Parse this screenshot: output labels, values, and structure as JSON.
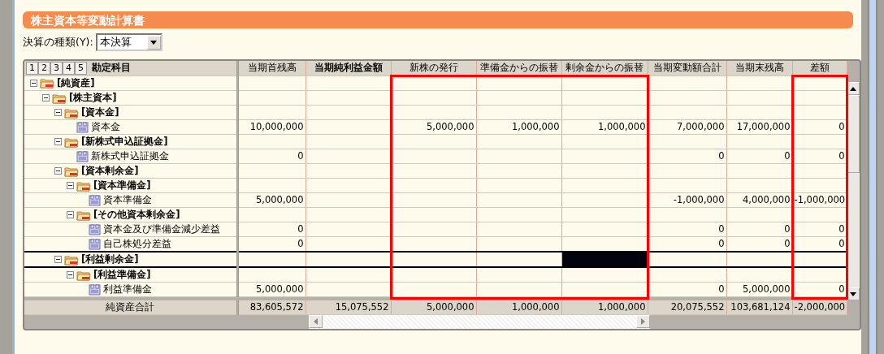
{
  "title": "株主資本等変動計算書",
  "settlement_type": {
    "label": "決算の種類(Y):",
    "value": "本決算"
  },
  "level_buttons": [
    "1",
    "2",
    "3",
    "4",
    "5"
  ],
  "tree_column": "勘定科目",
  "columns": [
    {
      "label": "当期首残高",
      "bold": false,
      "highlighted": false,
      "current": false
    },
    {
      "label": "当期純利益金額",
      "bold": true,
      "highlighted": false,
      "current": false
    },
    {
      "label": "新株の発行",
      "bold": false,
      "highlighted": true,
      "current": false
    },
    {
      "label": "準備金からの振替",
      "bold": false,
      "highlighted": true,
      "current": false
    },
    {
      "label": "剰余金からの振替",
      "bold": false,
      "highlighted": true,
      "current": true
    },
    {
      "label": "当期変動額合計",
      "bold": false,
      "highlighted": false,
      "current": false
    },
    {
      "label": "当期末残高",
      "bold": false,
      "highlighted": false,
      "current": false
    },
    {
      "label": "差額",
      "bold": false,
      "highlighted": true,
      "current": false
    }
  ],
  "rows": [
    {
      "kind": "group",
      "label": "[純資産]",
      "expanded": true,
      "selected": false,
      "children": [
        {
          "kind": "group",
          "label": "[株主資本]",
          "expanded": true,
          "selected": false,
          "children": [
            {
              "kind": "group",
              "label": "[資本金]",
              "expanded": true,
              "selected": false,
              "children": [
                {
                  "kind": "account",
                  "label": "資本金",
                  "selected": false,
                  "opening_balance": "10,000,000",
                  "new_shares": "5,000,000",
                  "reserve_transfer": "1,000,000",
                  "surplus_transfer": "1,000,000",
                  "total_change": "7,000,000",
                  "closing_balance": "17,000,000",
                  "difference": "0"
                }
              ]
            },
            {
              "kind": "group",
              "label": "[新株式申込証拠金]",
              "expanded": true,
              "selected": false,
              "children": [
                {
                  "kind": "account",
                  "label": "新株式申込証拠金",
                  "selected": false,
                  "opening_balance": "0",
                  "total_change": "0",
                  "closing_balance": "0",
                  "difference": "0"
                }
              ]
            },
            {
              "kind": "group",
              "label": "[資本剰余金]",
              "expanded": true,
              "selected": false,
              "children": [
                {
                  "kind": "group",
                  "label": "[資本準備金]",
                  "expanded": true,
                  "selected": false,
                  "children": [
                    {
                      "kind": "account",
                      "label": "資本準備金",
                      "selected": false,
                      "opening_balance": "5,000,000",
                      "total_change": "-1,000,000",
                      "closing_balance": "4,000,000",
                      "difference": "-1,000,000"
                    }
                  ]
                },
                {
                  "kind": "group",
                  "label": "[その他資本剰余金]",
                  "expanded": true,
                  "selected": false,
                  "children": [
                    {
                      "kind": "account",
                      "label": "資本金及び準備金減少差益",
                      "selected": false,
                      "opening_balance": "0",
                      "total_change": "0",
                      "closing_balance": "0",
                      "difference": "0"
                    },
                    {
                      "kind": "account",
                      "label": "自己株処分差益",
                      "selected": false,
                      "opening_balance": "0",
                      "total_change": "0",
                      "closing_balance": "0",
                      "difference": "0"
                    }
                  ]
                }
              ]
            },
            {
              "kind": "group",
              "label": "[利益剰余金]",
              "expanded": true,
              "selected": true,
              "children": [
                {
                  "kind": "group",
                  "label": "[利益準備金]",
                  "expanded": true,
                  "selected": false,
                  "children": [
                    {
                      "kind": "account",
                      "label": "利益準備金",
                      "selected": false,
                      "opening_balance": "5,000,000",
                      "total_change": "0",
                      "closing_balance": "5,000,000",
                      "difference": "0"
                    }
                  ]
                }
              ]
            }
          ]
        }
      ]
    }
  ],
  "total": {
    "label": "純資産合計",
    "values": [
      "83,605,572",
      "15,075,552",
      "5,000,000",
      "1,000,000",
      "1,000,000",
      "20,075,552",
      "103,681,124",
      "-2,000,000"
    ]
  }
}
